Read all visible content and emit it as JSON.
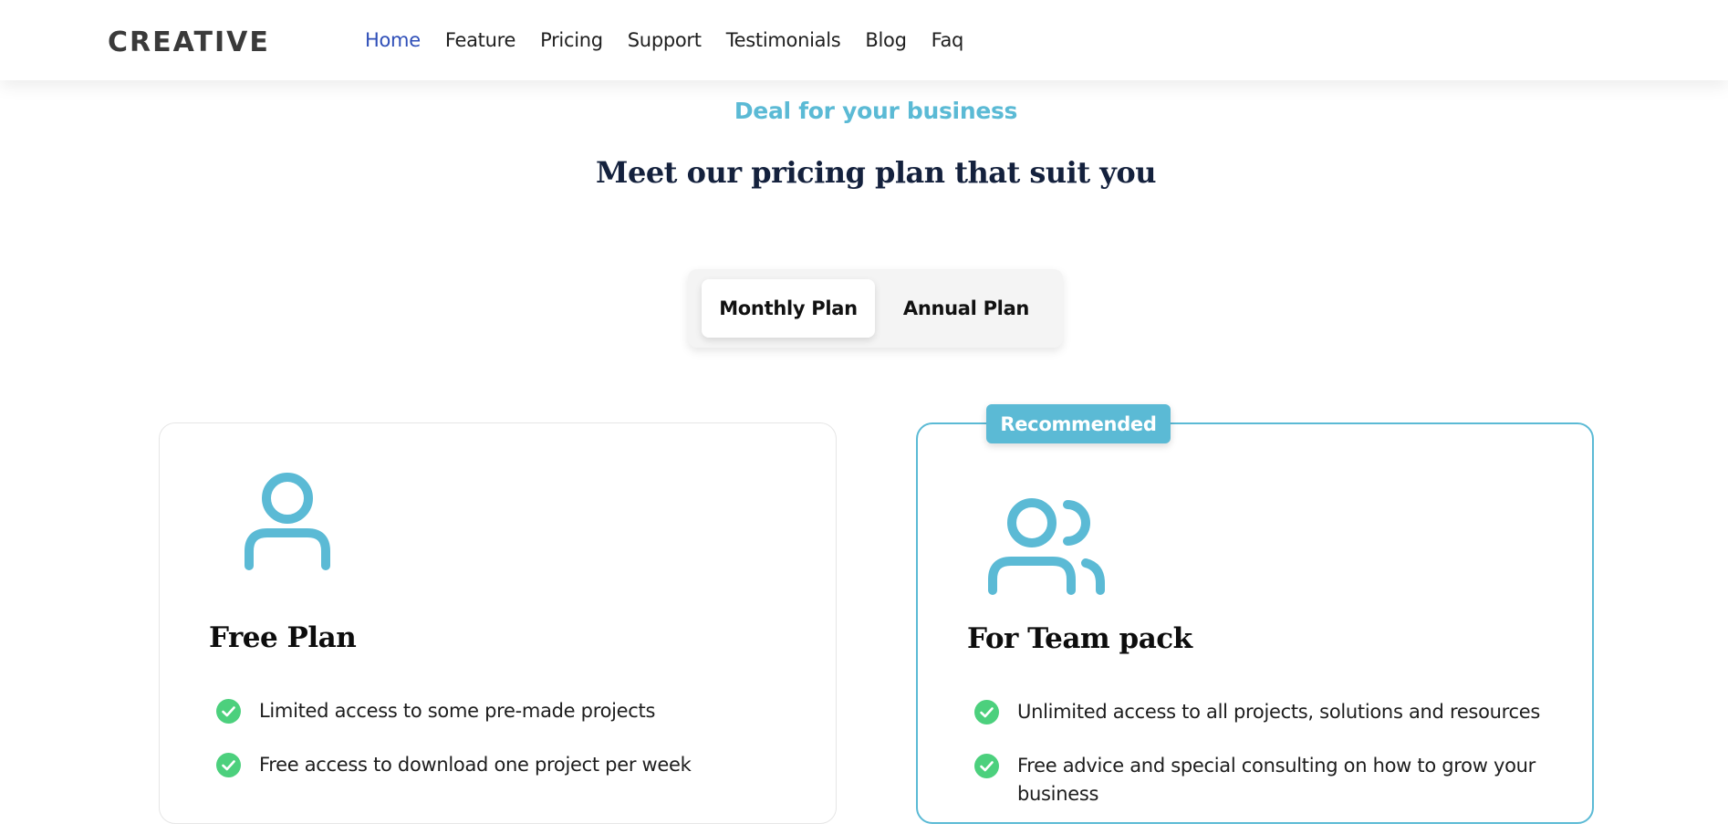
{
  "header": {
    "logo_text": "CREATIVE",
    "nav": [
      {
        "label": "Home",
        "active": true
      },
      {
        "label": "Feature",
        "active": false
      },
      {
        "label": "Pricing",
        "active": false
      },
      {
        "label": "Support",
        "active": false
      },
      {
        "label": "Testimonials",
        "active": false
      },
      {
        "label": "Blog",
        "active": false
      },
      {
        "label": "Faq",
        "active": false
      }
    ]
  },
  "pricing": {
    "subtitle": "Deal for your business",
    "title": "Meet our pricing plan that suit you",
    "toggle": {
      "monthly_label": "Monthly Plan",
      "annual_label": "Annual Plan",
      "selected": "Monthly Plan"
    },
    "plans": [
      {
        "name": "Free Plan",
        "icon": "user-icon",
        "features": [
          "Limited access to some pre-made projects",
          "Free access to download one project per week"
        ]
      },
      {
        "name": "For Team pack",
        "icon": "users-icon",
        "badge": "Recommended",
        "features": [
          "Unlimited access to all projects, solutions and resources",
          "Free advice and special consulting on how to grow your business"
        ]
      }
    ]
  },
  "colors": {
    "accent": "#5bbad5",
    "nav_active": "#2f4fb8",
    "heading": "#14213d",
    "check": "#4cd07d"
  }
}
